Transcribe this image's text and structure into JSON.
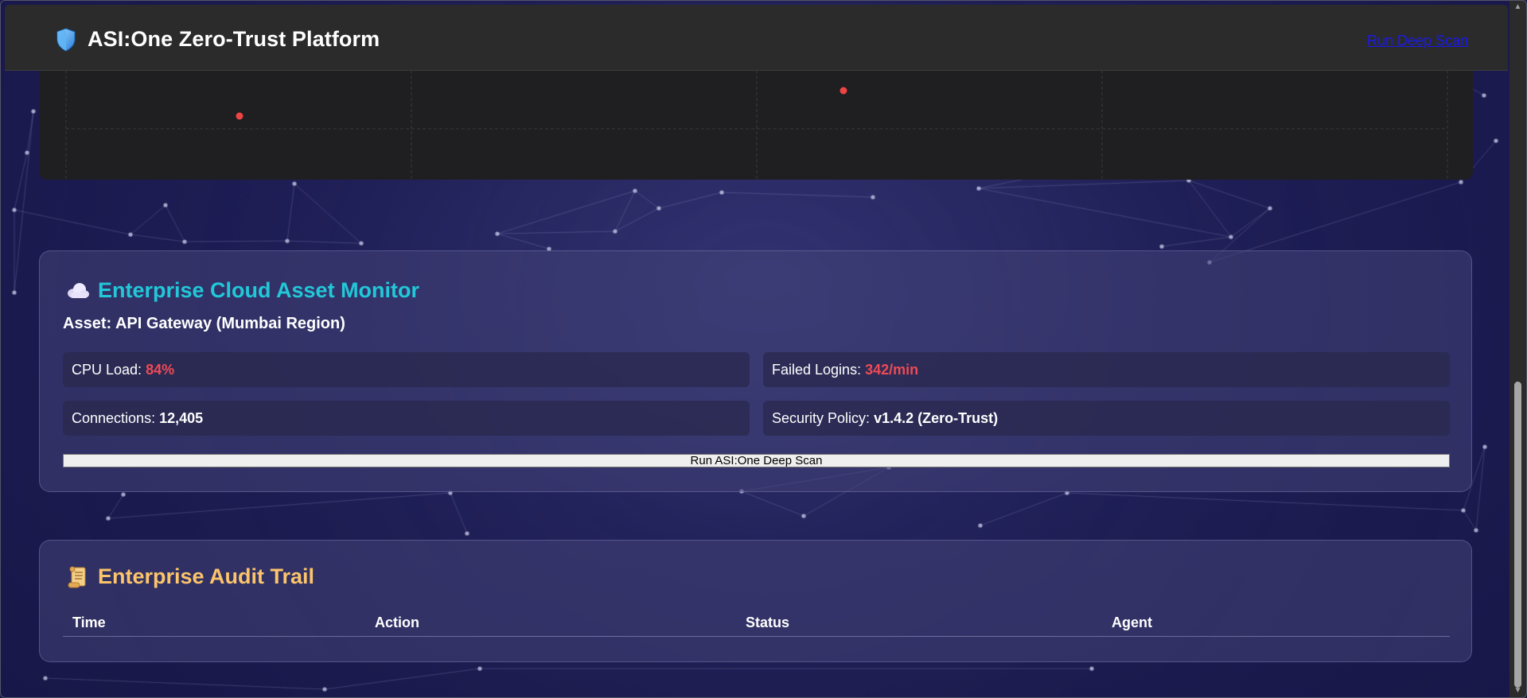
{
  "header": {
    "title": "ASI:One Zero-Trust Platform",
    "deep_scan_link": "Run Deep Scan"
  },
  "monitor": {
    "title": "Enterprise Cloud Asset Monitor",
    "asset": "Asset: API Gateway (Mumbai Region)",
    "stats": {
      "cpu_label": "CPU Load:",
      "cpu_value": "84%",
      "failed_label": "Failed Logins:",
      "failed_value": "342/min",
      "connections_label": "Connections:",
      "connections_value": "12,405",
      "policy_label": "Security Policy:",
      "policy_value": "v1.4.2 (Zero-Trust)"
    },
    "scan_button": "Run ASI:One Deep Scan"
  },
  "audit": {
    "title": "Enterprise Audit Trail",
    "columns": [
      "Time",
      "Action",
      "Status",
      "Agent"
    ]
  },
  "colors": {
    "accent_cyan": "#22c8d8",
    "accent_amber": "#fcc56a",
    "alert_red": "#ef4a55",
    "link_blue": "#1a1aee"
  },
  "icons": {
    "brand": "shield-icon",
    "monitor": "cloud-icon",
    "audit": "scroll-icon"
  }
}
